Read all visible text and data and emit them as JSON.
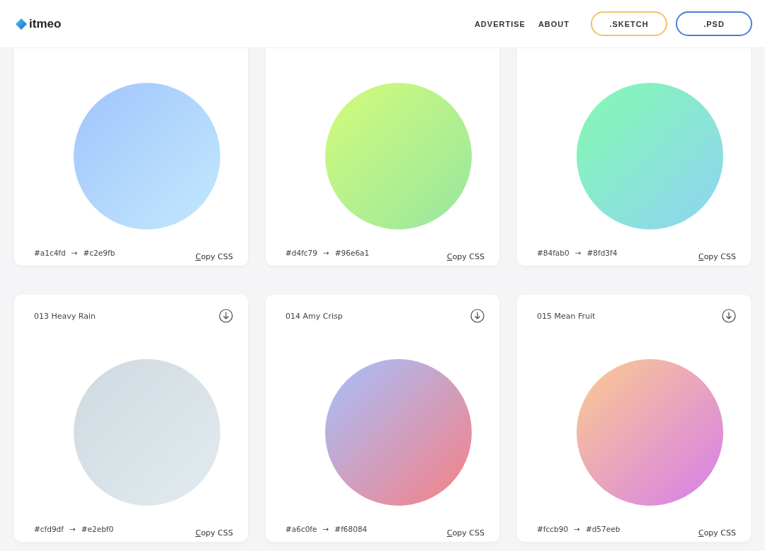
{
  "header": {
    "brand": "itmeo",
    "nav": [
      "ADVERTISE",
      "ABOUT"
    ],
    "buttons": [
      {
        "label": ".SKETCH",
        "color": "#f0c36a"
      },
      {
        "label": ".PSD",
        "color": "#4a7fd8"
      }
    ]
  },
  "cards": [
    {
      "from": "#a1c4fd",
      "to": "#c2e9fb",
      "arrow": "→",
      "action": "Copy CSS"
    },
    {
      "from": "#d4fc79",
      "to": "#96e6a1",
      "arrow": "→",
      "action": "Copy CSS"
    },
    {
      "from": "#84fab0",
      "to": "#8fd3f4",
      "arrow": "→",
      "action": "Copy CSS"
    },
    {
      "title": "013 Heavy Rain",
      "from": "#cfd9df",
      "to": "#e2ebf0",
      "arrow": "→",
      "action": "Copy CSS"
    },
    {
      "title": "014 Amy Crisp",
      "from": "#a6c0fe",
      "to": "#f68084",
      "arrow": "→",
      "action": "Copy CSS"
    },
    {
      "title": "015 Mean Fruit",
      "from": "#fccb90",
      "to": "#d57eeb",
      "arrow": "→",
      "action": "Copy CSS"
    }
  ]
}
